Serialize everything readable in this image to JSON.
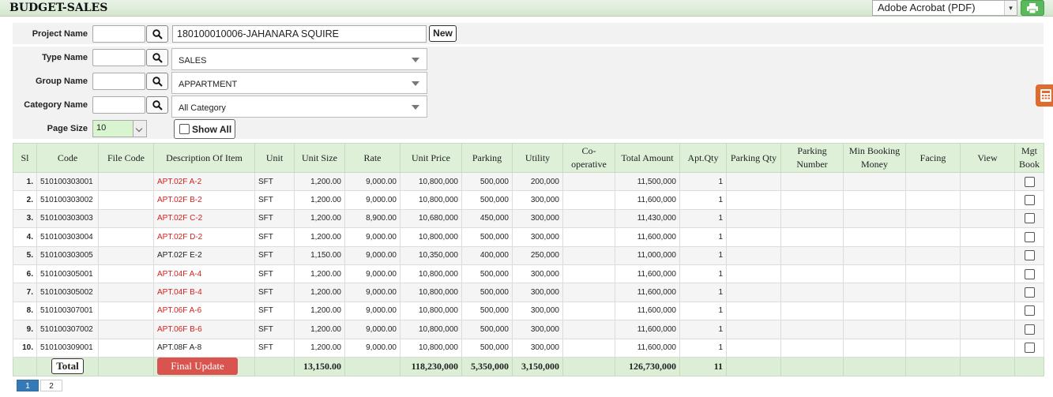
{
  "header": {
    "title": "BUDGET-SALES",
    "export_format": "Adobe Acrobat (PDF)"
  },
  "filters": {
    "project_label": "Project Name",
    "project_value": "180100010006-JAHANARA SQUIRE",
    "new_label": "New",
    "type_label": "Type Name",
    "type_value": "SALES",
    "group_label": "Group Name",
    "group_value": "APPARTMENT",
    "category_label": "Category Name",
    "category_value": "All Category",
    "pagesize_label": "Page Size",
    "pagesize_value": "10",
    "showall_label": "Show All"
  },
  "table": {
    "headers": [
      "Sl",
      "Code",
      "File Code",
      "Description Of Item",
      "Unit",
      "Unit Size",
      "Rate",
      "Unit Price",
      "Parking",
      "Utility",
      "Co-operative",
      "Total Amount",
      "Apt.Qty",
      "Parking Qty",
      "Parking Number",
      "Min Booking Money",
      "Facing",
      "View",
      "Mgt Book"
    ],
    "rows": [
      {
        "sl": "1.",
        "code": "510100303001",
        "file_code": "",
        "desc": "APT.02F A-2",
        "red": true,
        "unit": "SFT",
        "unit_size": "1,200.00",
        "rate": "9,000.00",
        "unit_price": "10,800,000",
        "parking": "500,000",
        "utility": "200,000",
        "coop": "",
        "total": "11,500,000",
        "qty": "1"
      },
      {
        "sl": "2.",
        "code": "510100303002",
        "file_code": "",
        "desc": "APT.02F B-2",
        "red": true,
        "unit": "SFT",
        "unit_size": "1,200.00",
        "rate": "9,000.00",
        "unit_price": "10,800,000",
        "parking": "500,000",
        "utility": "300,000",
        "coop": "",
        "total": "11,600,000",
        "qty": "1"
      },
      {
        "sl": "3.",
        "code": "510100303003",
        "file_code": "",
        "desc": "APT.02F C-2",
        "red": true,
        "unit": "SFT",
        "unit_size": "1,200.00",
        "rate": "8,900.00",
        "unit_price": "10,680,000",
        "parking": "450,000",
        "utility": "300,000",
        "coop": "",
        "total": "11,430,000",
        "qty": "1"
      },
      {
        "sl": "4.",
        "code": "510100303004",
        "file_code": "",
        "desc": "APT.02F D-2",
        "red": true,
        "unit": "SFT",
        "unit_size": "1,200.00",
        "rate": "9,000.00",
        "unit_price": "10,800,000",
        "parking": "500,000",
        "utility": "300,000",
        "coop": "",
        "total": "11,600,000",
        "qty": "1"
      },
      {
        "sl": "5.",
        "code": "510100303005",
        "file_code": "",
        "desc": "APT.02F E-2",
        "red": false,
        "unit": "SFT",
        "unit_size": "1,150.00",
        "rate": "9,000.00",
        "unit_price": "10,350,000",
        "parking": "400,000",
        "utility": "250,000",
        "coop": "",
        "total": "11,000,000",
        "qty": "1"
      },
      {
        "sl": "6.",
        "code": "510100305001",
        "file_code": "",
        "desc": "APT.04F A-4",
        "red": true,
        "unit": "SFT",
        "unit_size": "1,200.00",
        "rate": "9,000.00",
        "unit_price": "10,800,000",
        "parking": "500,000",
        "utility": "300,000",
        "coop": "",
        "total": "11,600,000",
        "qty": "1"
      },
      {
        "sl": "7.",
        "code": "510100305002",
        "file_code": "",
        "desc": "APT.04F B-4",
        "red": true,
        "unit": "SFT",
        "unit_size": "1,200.00",
        "rate": "9,000.00",
        "unit_price": "10,800,000",
        "parking": "500,000",
        "utility": "300,000",
        "coop": "",
        "total": "11,600,000",
        "qty": "1"
      },
      {
        "sl": "8.",
        "code": "510100307001",
        "file_code": "",
        "desc": "APT.06F A-6",
        "red": true,
        "unit": "SFT",
        "unit_size": "1,200.00",
        "rate": "9,000.00",
        "unit_price": "10,800,000",
        "parking": "500,000",
        "utility": "300,000",
        "coop": "",
        "total": "11,600,000",
        "qty": "1"
      },
      {
        "sl": "9.",
        "code": "510100307002",
        "file_code": "",
        "desc": "APT.06F B-6",
        "red": true,
        "unit": "SFT",
        "unit_size": "1,200.00",
        "rate": "9,000.00",
        "unit_price": "10,800,000",
        "parking": "500,000",
        "utility": "300,000",
        "coop": "",
        "total": "11,600,000",
        "qty": "1"
      },
      {
        "sl": "10.",
        "code": "510100309001",
        "file_code": "",
        "desc": "APT.08F A-8",
        "red": false,
        "unit": "SFT",
        "unit_size": "1,200.00",
        "rate": "9,000.00",
        "unit_price": "10,800,000",
        "parking": "500,000",
        "utility": "300,000",
        "coop": "",
        "total": "11,600,000",
        "qty": "1"
      }
    ],
    "footer": {
      "total_label": "Total",
      "final_update_label": "Final Update",
      "unit_size": "13,150.00",
      "unit_price": "118,230,000",
      "parking": "5,350,000",
      "utility": "3,150,000",
      "total": "126,730,000",
      "qty": "11"
    }
  },
  "pagination": {
    "pages": [
      "1",
      "2"
    ],
    "current": "1"
  },
  "colors": {
    "header_bg": "#def0d8",
    "red_text": "#d42020",
    "final_button": "#d9534f",
    "print_button": "#5cb85c",
    "calc_tab": "#e06b2e",
    "page_active": "#337ab7"
  },
  "icons": {
    "search": "search-icon",
    "print": "printer-icon",
    "calculator": "calculator-icon"
  }
}
